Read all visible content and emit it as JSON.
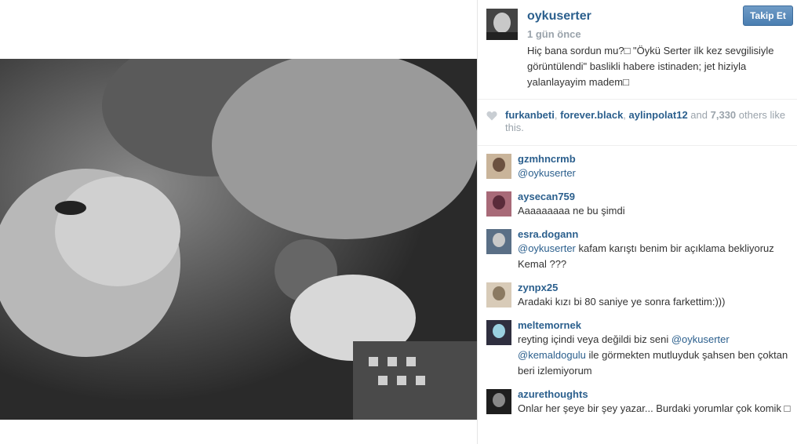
{
  "post": {
    "username": "oykuserter",
    "time": "1 gün önce",
    "follow_label": "Takip Et",
    "caption": "Hiç bana sordun mu?□ \"Öykü Serter ilk kez sevgilisiyle görüntülendi\" baslikli habere istinaden; jet hiziyla yalanlayayim madem□",
    "photo_alt": "Black and white selfie photo"
  },
  "likes": {
    "users": [
      "furkanbeti",
      "forever.black",
      "aylinpolat12"
    ],
    "and_word": "and",
    "count": "7,330",
    "suffix": "others like this."
  },
  "comments": [
    {
      "user": "gzmhncrmb",
      "parts": [
        {
          "mention": "@oykuserter"
        }
      ]
    },
    {
      "user": "aysecan759",
      "parts": [
        {
          "text": "Aaaaaaaaa ne bu şimdi"
        }
      ]
    },
    {
      "user": "esra.dogann",
      "parts": [
        {
          "mention": "@oykuserter"
        },
        {
          "text": " kafam karıştı benim bir açıklama bekliyoruz Kemal ???"
        }
      ]
    },
    {
      "user": "zynpx25",
      "parts": [
        {
          "text": "Aradaki kızı bi 80 saniye ye sonra farkettim:)))"
        }
      ]
    },
    {
      "user": "meltemornek",
      "parts": [
        {
          "text": "reyting içindi veya değildi biz seni "
        },
        {
          "mention": "@oykuserter"
        },
        {
          "text": " "
        },
        {
          "mention": "@kemaldogulu"
        },
        {
          "text": " ile görmekten mutluyduk şahsen ben çoktan beri izlemiyorum"
        }
      ]
    },
    {
      "user": "azurethoughts",
      "parts": [
        {
          "text": "Onlar her şeye bir şey yazar... Burdaki yorumlar çok komik □"
        }
      ]
    }
  ],
  "colors": {
    "link": "#2b5f8d",
    "muted": "#9aa3ab",
    "button": "#4a7eb1"
  }
}
